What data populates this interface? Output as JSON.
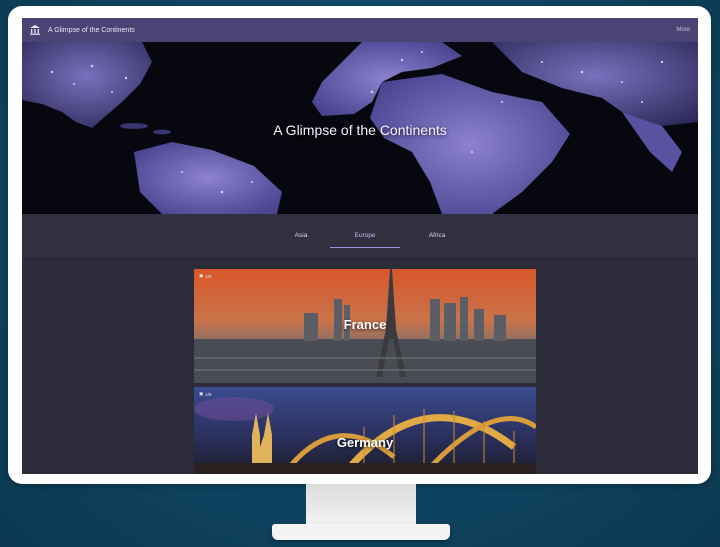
{
  "app": {
    "title": "A Glimpse of the Continents",
    "more_label": "More"
  },
  "hero": {
    "title": "A Glimpse of the Continents"
  },
  "tabs": [
    {
      "label": "Asia",
      "active": false
    },
    {
      "label": "Europe",
      "active": true
    },
    {
      "label": "Africa",
      "active": false
    }
  ],
  "cards": [
    {
      "label": "France",
      "badge": "1/8"
    },
    {
      "label": "Germany",
      "badge": "1/8"
    }
  ],
  "colors": {
    "header": "#4a4475",
    "accent": "#9b93dc",
    "background": "#2b2b3a"
  }
}
